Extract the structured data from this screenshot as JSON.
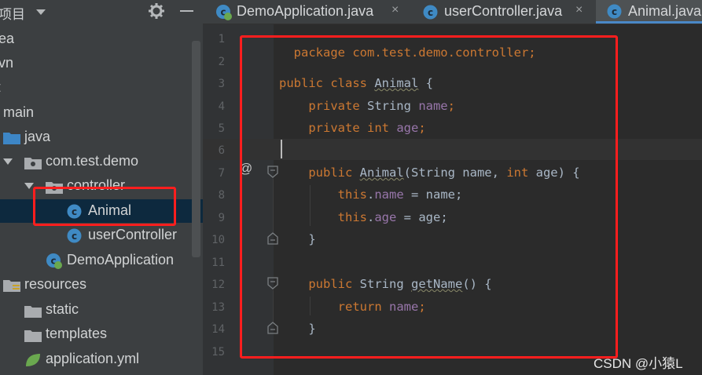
{
  "project_panel": {
    "title": "项目",
    "tree": [
      {
        "label": "ea",
        "icon": "none"
      },
      {
        "label": "vn",
        "icon": "none"
      },
      {
        "label": "t",
        "icon": "none"
      },
      {
        "label": "main",
        "icon": "none"
      },
      {
        "label": "java",
        "icon": "folder-blue-icon"
      },
      {
        "label": "com.test.demo",
        "icon": "package-icon"
      },
      {
        "label": "controller",
        "icon": "package-icon"
      },
      {
        "label": "Animal",
        "icon": "class-icon",
        "selected": true
      },
      {
        "label": "userController",
        "icon": "class-icon"
      },
      {
        "label": "DemoApplication",
        "icon": "spring-class-icon"
      },
      {
        "label": "resources",
        "icon": "resources-folder-icon"
      },
      {
        "label": "static",
        "icon": "folder-icon"
      },
      {
        "label": "templates",
        "icon": "folder-icon"
      },
      {
        "label": "application.yml",
        "icon": "spring-yml-icon"
      }
    ]
  },
  "tabs": [
    {
      "label": "DemoApplication.java",
      "close": "×",
      "icon": "spring-class-icon"
    },
    {
      "label": "userController.java",
      "close": "×",
      "icon": "class-icon"
    },
    {
      "label": "Animal.java",
      "close": "",
      "icon": "class-icon",
      "active": true
    }
  ],
  "editor": {
    "line_numbers": [
      "1",
      "2",
      "3",
      "4",
      "5",
      "6",
      "7",
      "8",
      "9",
      "10",
      "11",
      "12",
      "13",
      "14",
      "15"
    ],
    "override_marker": "@",
    "code": {
      "l1": "package com.test.demo.controller;",
      "l3_kw": "public class ",
      "l3_name": "Animal",
      "l3_rest": " {",
      "l4_kw": "    private ",
      "l4_type": "String ",
      "l4_field": "name",
      "l4_end": ";",
      "l5_kw": "    private int ",
      "l5_field": "age",
      "l5_end": ";",
      "l7_kw": "    public ",
      "l7_name": "Animal",
      "l7_a": "(String name, ",
      "l7_kw2": "int",
      "l7_b": " age) {",
      "l8_kw": "        this",
      "l8_dot": ".",
      "l8_field": "name",
      "l8_rest": " = name;",
      "l9_kw": "        this",
      "l9_dot": ".",
      "l9_field": "age",
      "l9_rest": " = age;",
      "l10": "    }",
      "l12_kw": "    public ",
      "l12_type": "String ",
      "l12_name": "getName",
      "l12_rest": "() {",
      "l13_kw": "        return ",
      "l13_field": "name",
      "l13_end": ";",
      "l14": "    }"
    }
  },
  "watermark": "CSDN @小猿L",
  "colors": {
    "annotation_red": "#ff1e1e",
    "selection": "#0d293e",
    "keyword": "#cc7832",
    "field": "#9876aa"
  }
}
